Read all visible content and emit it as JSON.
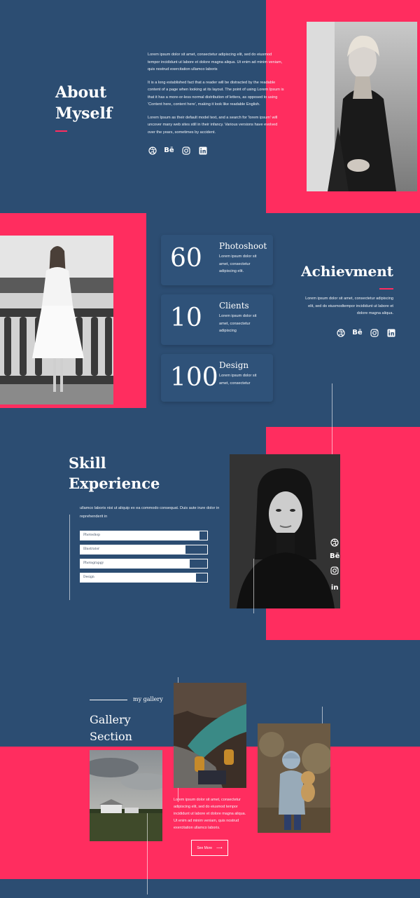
{
  "about": {
    "title_line1": "About",
    "title_line2": "Myself",
    "para1": "Lorem ipsum dolor sit amet, consectetur adipiscing elit, sed do eiusmod tempor incididunt ut labore et dolore magna aliqua. Ut enim ad minim veniam, quis nostrud exercitation ullamco laboris",
    "para2": "It is a long established fact that a reader will be distracted by the readable content of a page when looking at its layout. The point of using Lorem Ipsum is that it has a more-or-less normal distribution of letters, as opposed to using 'Content here, content here', making it look like readable English.",
    "para3": "Lorem Ipsum as their default model text, and a search for 'lorem ipsum' will uncover many web sites still in their infancy. Various versions have evolved over the years, sometimes by accident."
  },
  "social": {
    "dribbble": "dribbble-icon",
    "behance": "Bē",
    "instagram": "instagram-icon",
    "linkedin": "in"
  },
  "achievement": {
    "title": "Achievment",
    "text": "Lorem ipsum dolor sit amet, consectetur adipiscing elit, sed do eiusmodtempor incididunt ut labore et dolore magna aliqua.",
    "cards": [
      {
        "number": "60",
        "title": "Photoshoot",
        "text": "Lorem ipsum dolor sit amet, consectetur adipiscing elit."
      },
      {
        "number": "10",
        "title": "Clients",
        "text": "Lorem ipsum dolor sit amet, consectetur adipiscing"
      },
      {
        "number": "100",
        "title": "Design",
        "text": "Lorem ipsum dolor sit amet, consectetur"
      }
    ]
  },
  "skill": {
    "title_line1": "Skill",
    "title_line2": "Experience",
    "text": "ullamco laboris nisi ut aliquip ex ea commodo consequat. Duis aute irure dolor in reprehenderit in",
    "bars": [
      {
        "label": "Photoshop",
        "percent": 94
      },
      {
        "label": "Illustrator",
        "percent": 83
      },
      {
        "label": "Photograpgy",
        "percent": 86
      },
      {
        "label": "Design",
        "percent": 91
      }
    ]
  },
  "gallery": {
    "kicker": "my gallery",
    "title_line1": "Gallery",
    "title_line2": "Section",
    "text": "Lorem ipsum dolor sit amet, consectetur adipiscing elit, sed do eiusmod tempor incididunt ut labore et dolore magna aliqua. Ut enim ad minim veniam, quis nostrud exercitation ullamco laboris.",
    "button": "See More",
    "button_arrow": "⟶"
  },
  "colors": {
    "navy": "#2c4d72",
    "pink": "#ff2d5f"
  }
}
